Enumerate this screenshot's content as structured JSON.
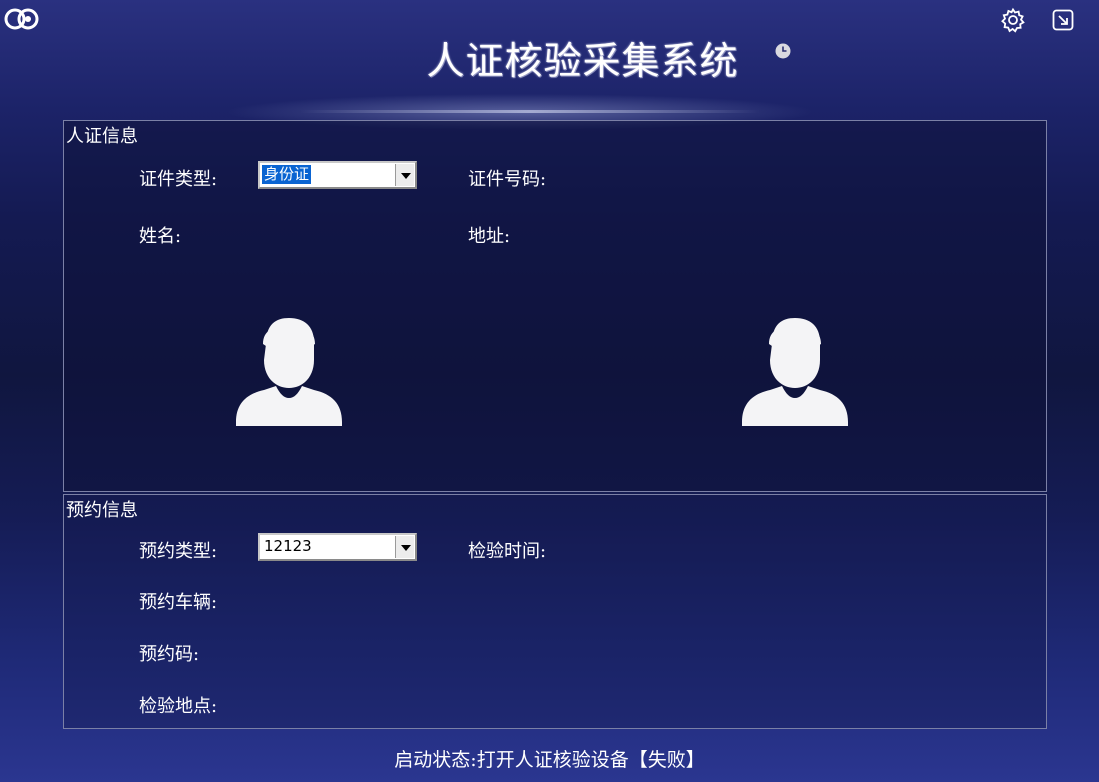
{
  "app": {
    "title": "人证核验采集系统",
    "icons": {
      "logo": "app-logo",
      "clock": "clock-icon",
      "settings": "gear-icon",
      "exit": "exit-icon"
    }
  },
  "id_info": {
    "section_title": "人证信息",
    "doc_type_label": "证件类型:",
    "doc_type_value": "身份证",
    "doc_number_label": "证件号码:",
    "name_label": "姓名:",
    "address_label": "地址:",
    "photos": [
      "id-card-photo-placeholder",
      "live-capture-photo-placeholder"
    ]
  },
  "appointment": {
    "section_title": "预约信息",
    "type_label": "预约类型:",
    "type_value": "12123",
    "inspection_time_label": "检验时间:",
    "vehicle_label": "预约车辆:",
    "code_label": "预约码:",
    "location_label": "检验地点:"
  },
  "status": {
    "text": "启动状态:打开人证核验设备【失败】"
  },
  "colors": {
    "background_top": "#2a3180",
    "background_mid": "#10163f",
    "panel_border": "#7b80a6",
    "selection_highlight": "#0a64d2"
  }
}
